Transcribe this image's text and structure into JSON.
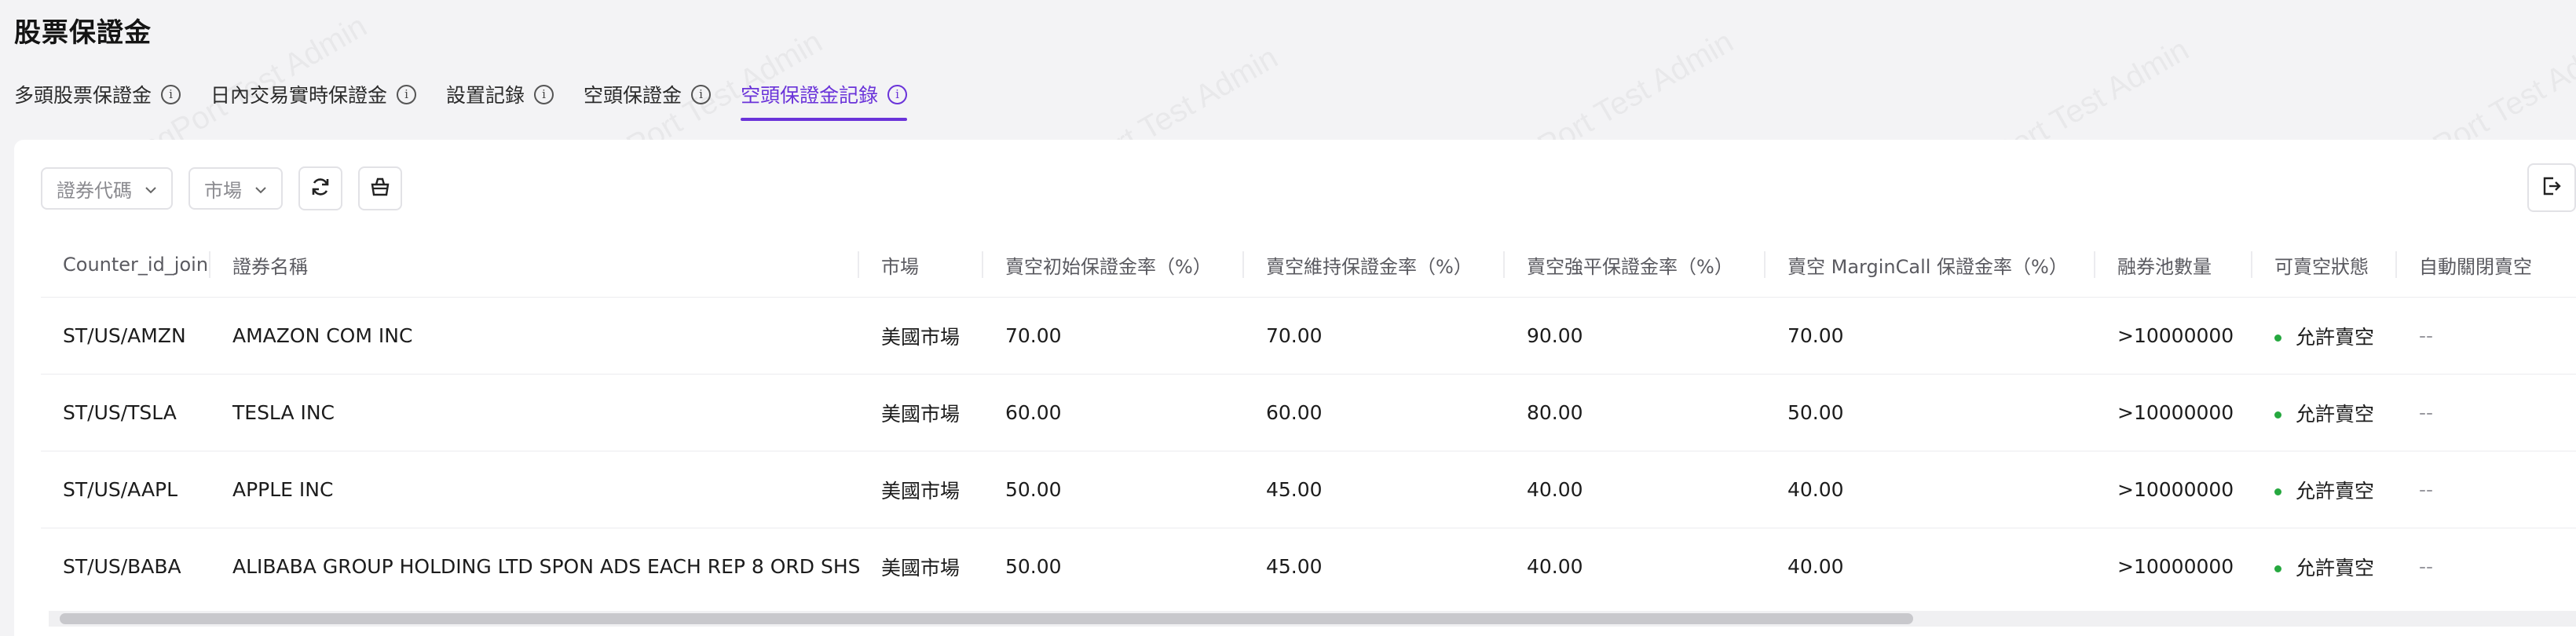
{
  "page_title": "股票保證金",
  "tabs": [
    {
      "label": "多頭股票保證金",
      "active": false
    },
    {
      "label": "日內交易實時保證金",
      "active": false
    },
    {
      "label": "設置記錄",
      "active": false
    },
    {
      "label": "空頭保證金",
      "active": false
    },
    {
      "label": "空頭保證金記錄",
      "active": true
    }
  ],
  "tab_info_glyph": "i",
  "filters": {
    "security_code_placeholder": "證券代碼",
    "market_placeholder": "市場"
  },
  "icons": {
    "refresh": "refresh-icon",
    "basket": "basket-icon",
    "export": "export-icon",
    "info": "info-icon",
    "chevron": "chevron-down-icon"
  },
  "table": {
    "columns": [
      "Counter_id_join",
      "證券名稱",
      "市場",
      "賣空初始保證金率（%）",
      "賣空維持保證金率（%）",
      "賣空強平保證金率（%）",
      "賣空 MarginCall 保證金率（%）",
      "融券池數量",
      "可賣空狀態",
      "自動關閉賣空"
    ],
    "rows": [
      {
        "counter": "ST/US/AMZN",
        "name": "AMAZON COM INC",
        "market": "美國市場",
        "initial": "70.00",
        "maintenance": "70.00",
        "liquidation": "90.00",
        "margin_call": "70.00",
        "pool": ">10000000",
        "status": "允許賣空",
        "auto_close": "--"
      },
      {
        "counter": "ST/US/TSLA",
        "name": "TESLA INC",
        "market": "美國市場",
        "initial": "60.00",
        "maintenance": "60.00",
        "liquidation": "80.00",
        "margin_call": "50.00",
        "pool": ">10000000",
        "status": "允許賣空",
        "auto_close": "--"
      },
      {
        "counter": "ST/US/AAPL",
        "name": "APPLE INC",
        "market": "美國市場",
        "initial": "50.00",
        "maintenance": "45.00",
        "liquidation": "40.00",
        "margin_call": "40.00",
        "pool": ">10000000",
        "status": "允許賣空",
        "auto_close": "--"
      },
      {
        "counter": "ST/US/BABA",
        "name": "ALIBABA GROUP HOLDING LTD SPON ADS EACH REP 8 ORD SHS",
        "market": "美國市場",
        "initial": "50.00",
        "maintenance": "45.00",
        "liquidation": "40.00",
        "margin_call": "40.00",
        "pool": ">10000000",
        "status": "允許賣空",
        "auto_close": "--"
      }
    ]
  },
  "watermark_text": "LongPort Test Admin",
  "colors": {
    "accent": "#6a33d9",
    "status_ok": "#26a83f",
    "background": "#f3f3f5"
  }
}
